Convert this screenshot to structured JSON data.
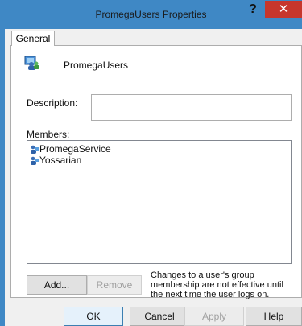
{
  "window": {
    "title": "PromegaUsers Properties",
    "help_glyph": "?",
    "close_glyph": "✕"
  },
  "tabs": [
    {
      "label": "General",
      "active": true
    }
  ],
  "group": {
    "icon": "group-users-icon",
    "name": "PromegaUsers"
  },
  "description": {
    "label": "Description:",
    "value": ""
  },
  "members": {
    "label": "Members:",
    "items": [
      {
        "name": "PromegaService",
        "icon": "user-icon"
      },
      {
        "name": "Yossarian",
        "icon": "user-icon"
      }
    ]
  },
  "member_buttons": {
    "add": "Add...",
    "remove": "Remove"
  },
  "note": "Changes to a user's group membership are not effective until the next time the user logs on.",
  "dialog_buttons": {
    "ok": "OK",
    "cancel": "Cancel",
    "apply": "Apply",
    "help": "Help"
  },
  "colors": {
    "title_bar": "#3f88c5",
    "close_button": "#c7362c",
    "dialog_bg": "#f0f0f0"
  }
}
